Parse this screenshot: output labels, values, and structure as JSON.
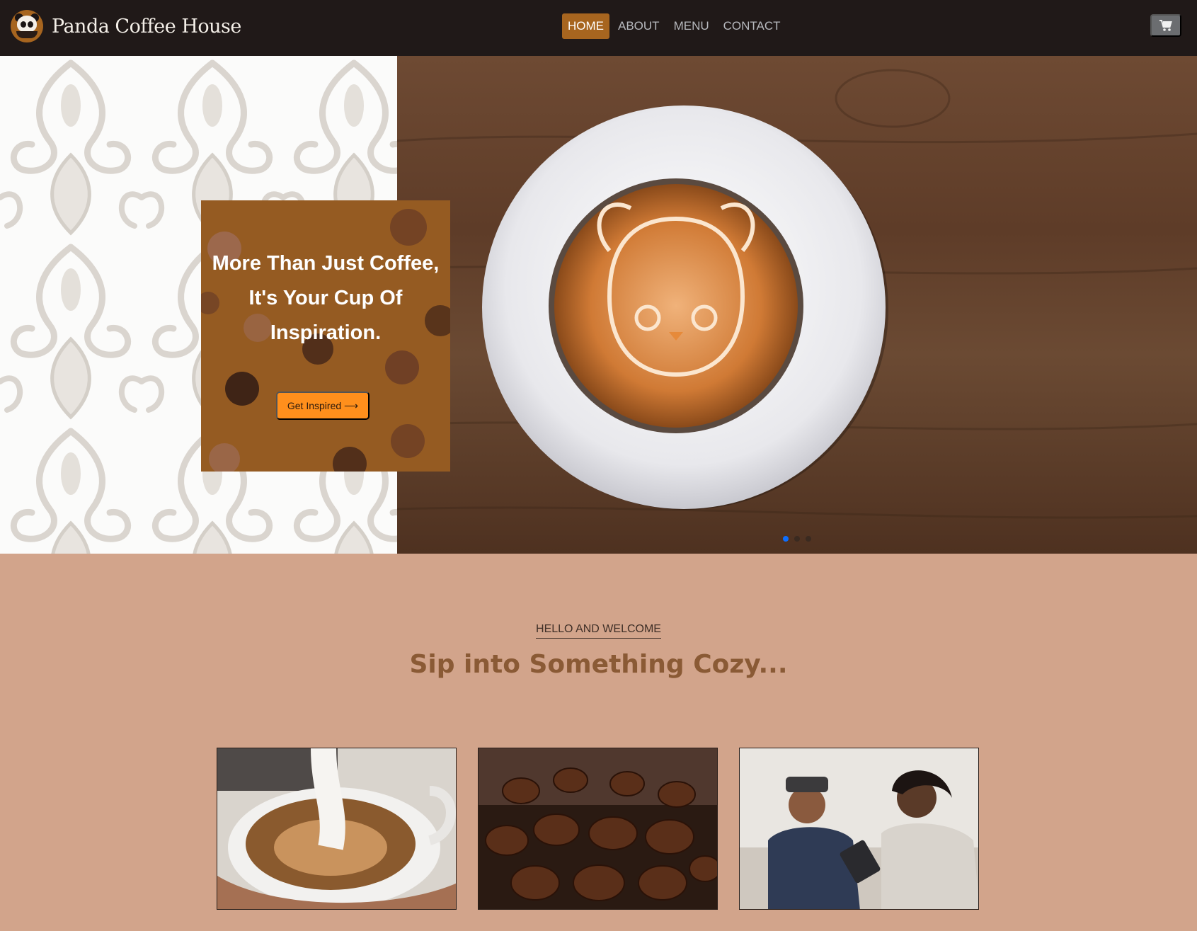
{
  "navbar": {
    "brand_name": "Panda Coffee House",
    "items": [
      {
        "label": "HOME",
        "active": true
      },
      {
        "label": "ABOUT",
        "active": false
      },
      {
        "label": "MENU",
        "active": false
      },
      {
        "label": "CONTACT",
        "active": false
      }
    ],
    "cart_icon": "cart-icon"
  },
  "hero": {
    "headline": "More Than Just Coffee, It's Your Cup Of Inspiration.",
    "cta_label": "Get Inspired ⟶",
    "carousel": {
      "slides": 3,
      "active_index": 0
    }
  },
  "welcome": {
    "eyebrow": "HELLO AND WELCOME",
    "title": "Sip into Something Cozy..."
  },
  "colors": {
    "navbar_bg": "#201918",
    "accent": "#a7651f",
    "card_bg": "#955b22",
    "cta_bg": "#ff8f1c",
    "section_bg": "#d2a48b",
    "title_color": "#8a5a35"
  }
}
